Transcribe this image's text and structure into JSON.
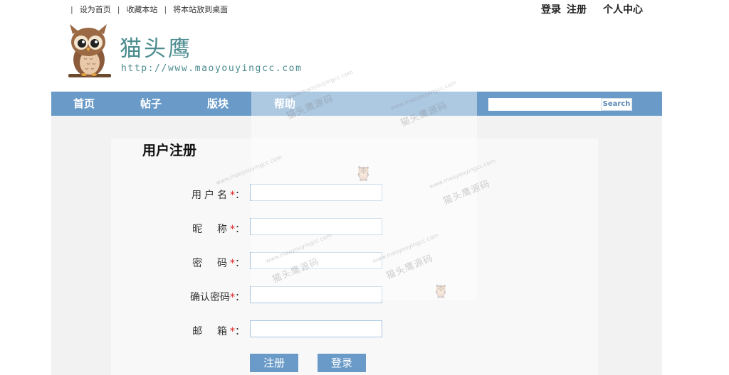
{
  "top_links": {
    "set_home": "设为首页",
    "bookmark": "收藏本站",
    "desktop": "将本站放到桌面",
    "separator": "|"
  },
  "top_right": {
    "login": "登录",
    "register": "注册",
    "profile": "个人中心"
  },
  "header": {
    "site_name": "猫头鹰",
    "site_url": "http://www.maoyouyingcc.com"
  },
  "nav": {
    "items": [
      "首页",
      "帖子",
      "版块",
      "帮助"
    ],
    "search_button": "Search",
    "search_value": ""
  },
  "form": {
    "title": "用户注册",
    "fields": [
      {
        "label": "用户名",
        "required_mark": "*",
        "colon": "：",
        "value": ""
      },
      {
        "label": "昵  称",
        "required_mark": "*",
        "colon": "：",
        "value": ""
      },
      {
        "label": "密  码",
        "required_mark": "*",
        "colon": "：",
        "value": ""
      },
      {
        "label": "确认密码",
        "required_mark": "*",
        "colon": "：",
        "value": ""
      },
      {
        "label": "邮  箱",
        "required_mark": "*",
        "colon": "：",
        "value": ""
      }
    ],
    "submit_label": "注册",
    "login_label": "登录"
  },
  "watermark": {
    "text": "猫头鹰源码",
    "url": "www.maoyouyingcc.com"
  },
  "colors": {
    "nav_bg": "#6a9bc8",
    "brand": "#4c8c8f",
    "required": "#e02020"
  }
}
